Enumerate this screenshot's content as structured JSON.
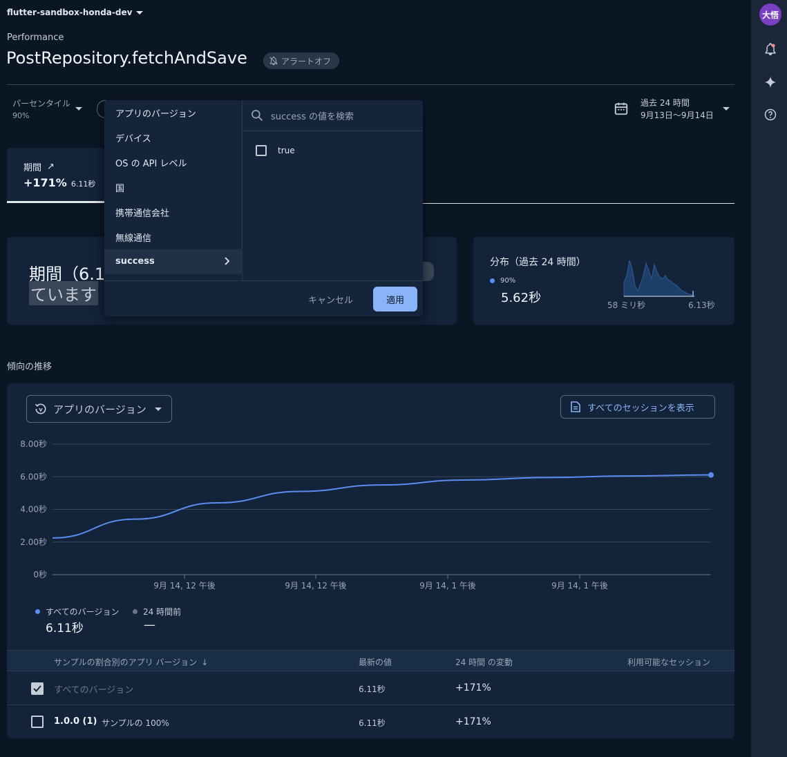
{
  "header": {
    "project": "flutter-sandbox-honda-dev",
    "section": "Performance",
    "title": "PostRepository.fetchAndSave",
    "alert_badge": "アラートオフ"
  },
  "filters": {
    "percentile_label": "パーセンタイル",
    "percentile_value": "90%",
    "date_label": "過去 24 時間",
    "date_range": "9月13日〜9月14日"
  },
  "metric_tab": {
    "label": "期間",
    "change": "+171%",
    "value": "6.11秒"
  },
  "filter_menu": {
    "items": [
      "アプリのバージョン",
      "デバイス",
      "OS の API レベル",
      "国",
      "携帯通信会社",
      "無線通信",
      "success"
    ],
    "search_placeholder": "success の値を検索",
    "options": [
      "true"
    ],
    "cancel": "キャンセル",
    "apply": "適用"
  },
  "summary_card": {
    "line1": "期間（6.1",
    "line2": "ています"
  },
  "distribution": {
    "title": "分布（過去 24 時間）",
    "percentile": "90%",
    "value": "5.62秒",
    "min_label": "58 ミリ秒",
    "max_label": "6.13秒"
  },
  "trend": {
    "heading": "傾向の推移",
    "dimension": "アプリのバージョン",
    "sessions_button": "すべてのセッションを表示",
    "legend_current_label": "すべてのバージョン",
    "legend_current_value": "6.11秒",
    "legend_prev_label": "24 時間前",
    "legend_prev_value": "—"
  },
  "chart_data": {
    "type": "line",
    "y_ticks": [
      "8.00秒",
      "6.00秒",
      "4.00秒",
      "2.00秒",
      "0秒"
    ],
    "ylim": [
      0,
      8
    ],
    "x_ticks": [
      "9月 14, 12 午後",
      "9月 14, 12 午後",
      "9月 14, 1 午後",
      "9月 14, 1 午後"
    ],
    "series": [
      {
        "name": "すべてのバージョン",
        "values": [
          2.25,
          3.4,
          4.4,
          5.1,
          5.5,
          5.8,
          5.95,
          6.05,
          6.11
        ],
        "color": "#5b8def"
      }
    ]
  },
  "table": {
    "headers": [
      "サンプルの割合別のアプリ バージョン",
      "最新の値",
      "24 時間 の変動",
      "利用可能なセッション"
    ],
    "rows": [
      {
        "name": "すべてのバージョン",
        "sample": "",
        "latest": "6.11秒",
        "change": "+171%",
        "checked": true
      },
      {
        "name": "1.0.0 (1)",
        "sample": "サンプルの 100%",
        "latest": "6.11秒",
        "change": "+171%",
        "checked": false
      }
    ]
  },
  "rail": {
    "avatar_text": "大悟"
  },
  "colors": {
    "accent": "#8ab4f8",
    "line": "#5b8def",
    "avatar": "#7b3fc4"
  }
}
